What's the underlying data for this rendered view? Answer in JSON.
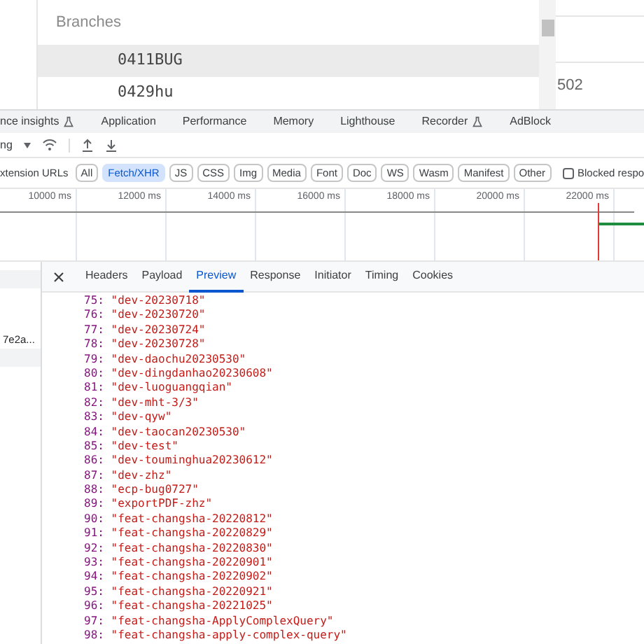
{
  "dropdown": {
    "header": "Branches",
    "items": [
      {
        "label": "0411BUG",
        "selected": true
      },
      {
        "label": "0429hu",
        "selected": false
      }
    ]
  },
  "side_value": "502",
  "devtools_tabs": [
    {
      "label": "nce insights",
      "experimental": true
    },
    {
      "label": "Application",
      "experimental": false
    },
    {
      "label": "Performance",
      "experimental": false
    },
    {
      "label": "Memory",
      "experimental": false
    },
    {
      "label": "Lighthouse",
      "experimental": false
    },
    {
      "label": "Recorder",
      "experimental": true
    },
    {
      "label": "AdBlock",
      "experimental": false
    }
  ],
  "toolbar": {
    "throttle": "ng"
  },
  "filter": {
    "label": "xtension URLs",
    "chips": [
      {
        "label": "All",
        "selected": false
      },
      {
        "label": "Fetch/XHR",
        "selected": true
      },
      {
        "label": "JS",
        "selected": false
      },
      {
        "label": "CSS",
        "selected": false
      },
      {
        "label": "Img",
        "selected": false
      },
      {
        "label": "Media",
        "selected": false
      },
      {
        "label": "Font",
        "selected": false
      },
      {
        "label": "Doc",
        "selected": false
      },
      {
        "label": "WS",
        "selected": false
      },
      {
        "label": "Wasm",
        "selected": false
      },
      {
        "label": "Manifest",
        "selected": false
      },
      {
        "label": "Other",
        "selected": false
      }
    ],
    "blocked": {
      "label": "Blocked respo",
      "checked": false
    }
  },
  "timeline": {
    "ticks": [
      "10000 ms",
      "12000 ms",
      "14000 ms",
      "16000 ms",
      "18000 ms",
      "20000 ms",
      "22000 ms"
    ]
  },
  "requests": [
    {
      "selected": true
    },
    {
      "name": "7e2a...",
      "selected": false
    },
    {
      "selected": true
    }
  ],
  "detail_tabs": [
    {
      "label": "Headers",
      "selected": false
    },
    {
      "label": "Payload",
      "selected": false
    },
    {
      "label": "Preview",
      "selected": true
    },
    {
      "label": "Response",
      "selected": false
    },
    {
      "label": "Initiator",
      "selected": false
    },
    {
      "label": "Timing",
      "selected": false
    },
    {
      "label": "Cookies",
      "selected": false
    }
  ],
  "preview_lines": [
    {
      "index": "75:",
      "value": "\"dev-20230718\""
    },
    {
      "index": "76:",
      "value": "\"dev-20230720\""
    },
    {
      "index": "77:",
      "value": "\"dev-20230724\""
    },
    {
      "index": "78:",
      "value": "\"dev-20230728\""
    },
    {
      "index": "79:",
      "value": "\"dev-daochu20230530\""
    },
    {
      "index": "80:",
      "value": "\"dev-dingdanhao20230608\""
    },
    {
      "index": "81:",
      "value": "\"dev-luoguangqian\""
    },
    {
      "index": "82:",
      "value": "\"dev-mht-3/3\""
    },
    {
      "index": "83:",
      "value": "\"dev-qyw\""
    },
    {
      "index": "84:",
      "value": "\"dev-taocan20230530\""
    },
    {
      "index": "85:",
      "value": "\"dev-test\""
    },
    {
      "index": "86:",
      "value": "\"dev-touminghua20230612\""
    },
    {
      "index": "87:",
      "value": "\"dev-zhz\""
    },
    {
      "index": "88:",
      "value": "\"ecp-bug0727\""
    },
    {
      "index": "89:",
      "value": "\"exportPDF-zhz\""
    },
    {
      "index": "90:",
      "value": "\"feat-changsha-20220812\""
    },
    {
      "index": "91:",
      "value": "\"feat-changsha-20220829\""
    },
    {
      "index": "92:",
      "value": "\"feat-changsha-20220830\""
    },
    {
      "index": "93:",
      "value": "\"feat-changsha-20220901\""
    },
    {
      "index": "94:",
      "value": "\"feat-changsha-20220902\""
    },
    {
      "index": "95:",
      "value": "\"feat-changsha-20220921\""
    },
    {
      "index": "96:",
      "value": "\"feat-changsha-20221025\""
    },
    {
      "index": "97:",
      "value": "\"feat-changsha-ApplyComplexQuery\""
    },
    {
      "index": "98:",
      "value": "\"feat-changsha-apply-complex-query\""
    }
  ]
}
